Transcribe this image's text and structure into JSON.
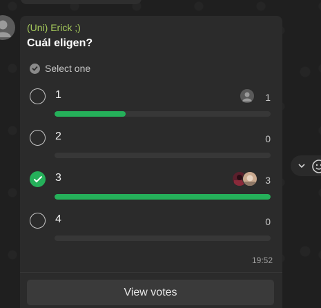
{
  "message": {
    "sender": "(Uni) Erick ;)",
    "question": "Cuál eligen?",
    "hint": "Select one",
    "time": "19:52",
    "view_votes_label": "View votes"
  },
  "poll": {
    "options": [
      {
        "label": "1",
        "votes": "1",
        "share": 0.33,
        "selected": false
      },
      {
        "label": "2",
        "votes": "0",
        "share": 0.0,
        "selected": false
      },
      {
        "label": "3",
        "votes": "3",
        "share": 1.0,
        "selected": true
      },
      {
        "label": "4",
        "votes": "0",
        "share": 0.0,
        "selected": false
      }
    ]
  },
  "colors": {
    "accent": "#25b05a",
    "sender": "#a5c95b",
    "bubble": "#2b2b2b"
  },
  "icons": {
    "avatar": "person-icon",
    "hint": "check-circle-icon",
    "selected": "check-icon",
    "menu": "chevron-down-icon",
    "react": "emoji-icon"
  }
}
